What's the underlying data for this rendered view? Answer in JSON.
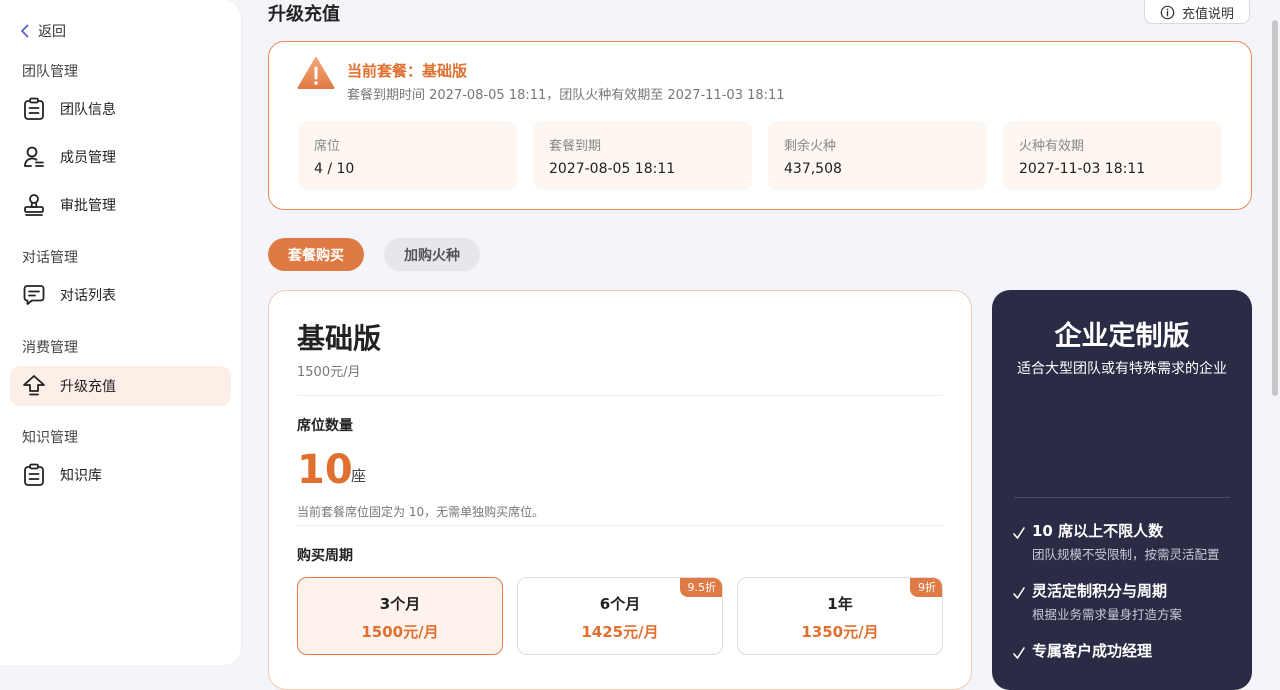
{
  "sidebar": {
    "back_label": "返回",
    "groups": [
      {
        "title": "团队管理"
      },
      {
        "title": "对话管理"
      },
      {
        "title": "消费管理"
      },
      {
        "title": "知识管理"
      }
    ],
    "items": [
      {
        "label": "团队信息",
        "icon": "clipboard-icon"
      },
      {
        "label": "成员管理",
        "icon": "user-manage-icon"
      },
      {
        "label": "审批管理",
        "icon": "stamp-icon"
      },
      {
        "label": "对话列表",
        "icon": "chat-icon"
      },
      {
        "label": "升级充值",
        "icon": "upgrade-icon",
        "active": true
      },
      {
        "label": "知识库",
        "icon": "clipboard-icon"
      }
    ]
  },
  "header": {
    "title": "升级充值",
    "help_label": "充值说明"
  },
  "current_plan": {
    "name": "当前套餐：基础版",
    "expire_text": "套餐到期时间 2027-08-05 18:11，团队火种有效期至 2027-11-03 18:11",
    "stats": [
      {
        "label": "席位",
        "value": "4 / 10"
      },
      {
        "label": "套餐到期",
        "value": "2027-08-05 18:11"
      },
      {
        "label": "剩余火种",
        "value": "437,508"
      },
      {
        "label": "火种有效期",
        "value": "2027-11-03 18:11"
      }
    ]
  },
  "tabs": [
    {
      "label": "套餐购买",
      "active": true
    },
    {
      "label": "加购火种",
      "active": false
    }
  ],
  "basic_plan": {
    "title": "基础版",
    "price": "1500元/月",
    "seats_title": "席位数量",
    "seats_value": "10",
    "seats_unit": "座",
    "seats_note": "当前套餐席位固定为 10，无需单独购买席位。",
    "period_title": "购买周期",
    "periods": [
      {
        "name": "3个月",
        "price": "1500元/月",
        "badge": "",
        "selected": true
      },
      {
        "name": "6个月",
        "price": "1425元/月",
        "badge": "9.5折",
        "selected": false
      },
      {
        "name": "1年",
        "price": "1350元/月",
        "badge": "9折",
        "selected": false
      }
    ]
  },
  "enterprise": {
    "title": "企业定制版",
    "subtitle": "适合大型团队或有特殊需求的企业",
    "features": [
      {
        "title": "10 席以上不限人数",
        "desc": "团队规模不受限制，按需灵活配置"
      },
      {
        "title": "灵活定制积分与周期",
        "desc": "根据业务需求量身打造方案"
      },
      {
        "title": "专属客户成功经理",
        "desc": ""
      }
    ]
  },
  "colors": {
    "accent": "#e07a44",
    "accent_text": "#e07030",
    "enterprise_bg": "#2a2b44"
  }
}
